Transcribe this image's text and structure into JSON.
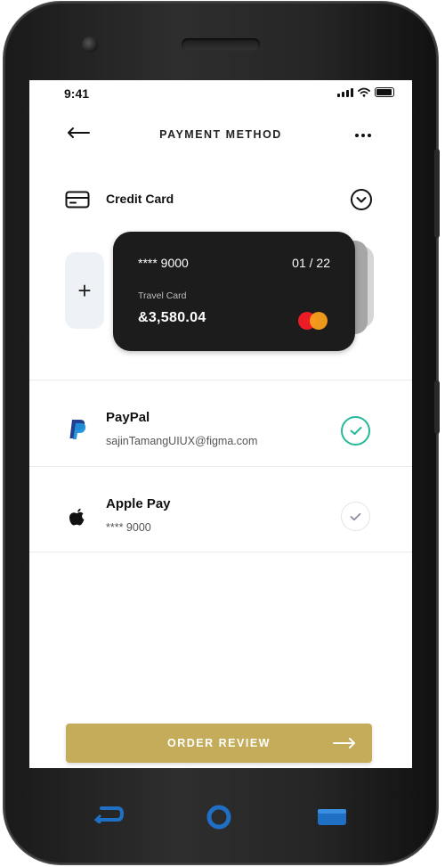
{
  "status_bar": {
    "time": "9:41"
  },
  "header": {
    "title": "PAYMENT METHOD",
    "back_icon": "arrow-left-icon",
    "more_icon": "more-dots-icon"
  },
  "credit_card_section": {
    "label": "Credit Card",
    "icon": "credit-card-icon",
    "toggle_icon": "chevron-down-icon",
    "add_label": "+"
  },
  "card": {
    "number": "**** 9000",
    "expiry": "01 / 22",
    "name": "Travel Card",
    "balance": "&3,580.04",
    "brand_icon": "mastercard-icon"
  },
  "payment_methods": [
    {
      "name": "PayPal",
      "detail": "sajinTamangUIUX@figma.com",
      "icon": "paypal-icon",
      "selected": true
    },
    {
      "name": "Apple Pay",
      "detail": "**** 9000",
      "icon": "apple-icon",
      "selected": false
    }
  ],
  "footer": {
    "order_button": "ORDER REVIEW",
    "order_icon": "arrow-right-icon"
  },
  "colors": {
    "accent": "#c4ac5b",
    "selected": "#23b99a",
    "card": "#1c1c1c",
    "nav_blue": "#1f6fc4"
  }
}
